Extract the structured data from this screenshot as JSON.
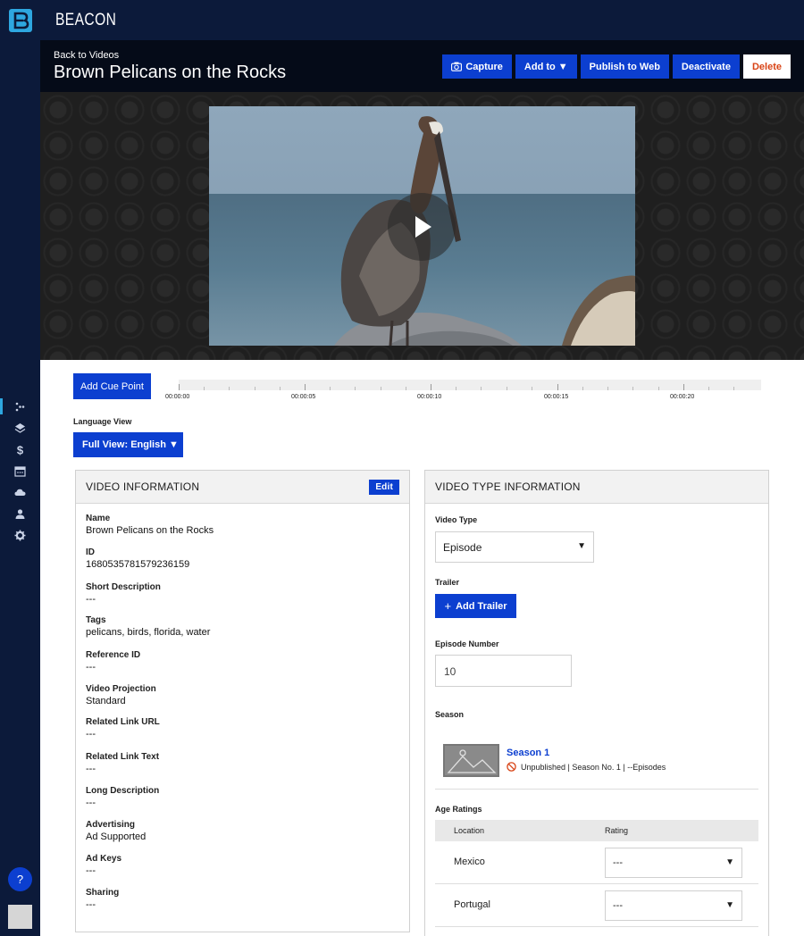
{
  "app": {
    "brand": "BEACON",
    "help_label": "?"
  },
  "sidebar": {
    "items": [
      {
        "name": "videos",
        "icon": "video-icon",
        "active": true
      },
      {
        "name": "layers",
        "icon": "layers-icon"
      },
      {
        "name": "monetization",
        "icon": "dollar-icon"
      },
      {
        "name": "schedule",
        "icon": "calendar-icon"
      },
      {
        "name": "cloud",
        "icon": "cloud-icon"
      },
      {
        "name": "users",
        "icon": "user-icon"
      },
      {
        "name": "settings",
        "icon": "gear-icon"
      }
    ]
  },
  "header": {
    "back_label": "Back to Videos",
    "title": "Brown Pelicans on the Rocks",
    "actions": {
      "capture": "Capture",
      "add_to": "Add to ▼",
      "publish": "Publish to Web",
      "deactivate": "Deactivate",
      "delete": "Delete"
    }
  },
  "timeline": {
    "cue_button": "Add Cue Point",
    "ticks": [
      "00:00:00",
      "00:00:05",
      "00:00:10",
      "00:00:15",
      "00:00:20"
    ]
  },
  "language": {
    "label": "Language View",
    "selected": "Full View: English ▼"
  },
  "video_info": {
    "heading": "VIDEO INFORMATION",
    "edit_label": "Edit",
    "fields": [
      {
        "label": "Name",
        "value": "Brown Pelicans on the Rocks"
      },
      {
        "label": "ID",
        "value": "1680535781579236159"
      },
      {
        "label": "Short Description",
        "value": "---"
      },
      {
        "label": "Tags",
        "value": "pelicans, birds, florida, water"
      },
      {
        "label": "Reference ID",
        "value": "---"
      },
      {
        "label": "Video Projection",
        "value": "Standard"
      },
      {
        "label": "Related Link URL",
        "value": "---"
      },
      {
        "label": "Related Link Text",
        "value": "---"
      },
      {
        "label": "Long Description",
        "value": "---"
      },
      {
        "label": "Advertising",
        "value": "Ad Supported"
      },
      {
        "label": "Ad Keys",
        "value": "---"
      },
      {
        "label": "Sharing",
        "value": "---"
      }
    ]
  },
  "video_type": {
    "heading": "VIDEO TYPE INFORMATION",
    "type_label": "Video Type",
    "type_value": "Episode",
    "trailer_label": "Trailer",
    "add_trailer": "Add Trailer",
    "episode_label": "Episode Number",
    "episode_value": "10",
    "season_label": "Season",
    "season_name": "Season 1",
    "season_status": "Unpublished | Season No. 1 | --Episodes",
    "ratings_label": "Age Ratings",
    "ratings_col_location": "Location",
    "ratings_col_rating": "Rating",
    "ratings": [
      {
        "location": "Mexico",
        "rating": "---"
      },
      {
        "location": "Portugal",
        "rating": "---"
      }
    ]
  },
  "colors": {
    "accent": "#0c3fd0",
    "nav_bg": "#0c1a3a",
    "danger": "#d84315"
  }
}
